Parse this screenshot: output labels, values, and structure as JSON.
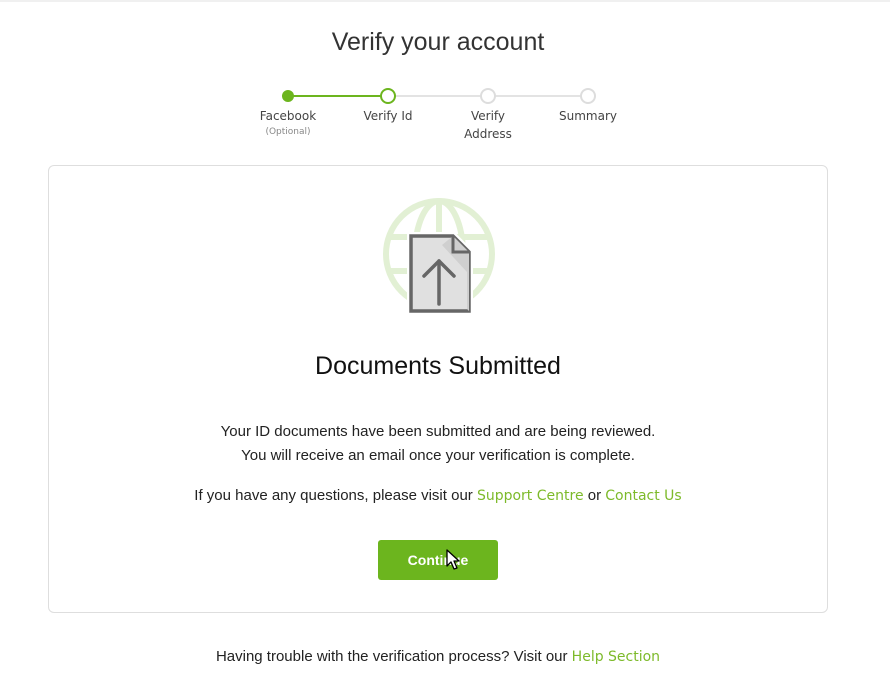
{
  "page": {
    "title": "Verify your account"
  },
  "stepper": {
    "steps": [
      {
        "label": "Facebook",
        "sublabel": "(Optional)",
        "state": "completed"
      },
      {
        "label": "Verify Id",
        "state": "current"
      },
      {
        "label_line1": "Verify",
        "label_line2": "Address",
        "state": "pending"
      },
      {
        "label": "Summary",
        "state": "pending"
      }
    ]
  },
  "card": {
    "icon": "document-upload-icon",
    "heading": "Documents Submitted",
    "message_line1": "Your ID documents have been submitted and are being reviewed.",
    "message_line2": "You will receive an email once your verification is complete.",
    "questions_prefix": "If you have any questions, please visit our",
    "support_link": "Support Centre",
    "questions_or": "or",
    "contact_link": "Contact Us",
    "continue_label": "Continue"
  },
  "footer": {
    "text": "Having trouble with the verification process? Visit our",
    "help_link": "Help Section"
  },
  "colors": {
    "accent": "#6cb51e",
    "link": "#7dba2a",
    "border": "#dedede",
    "pending_step": "#dddddd"
  }
}
